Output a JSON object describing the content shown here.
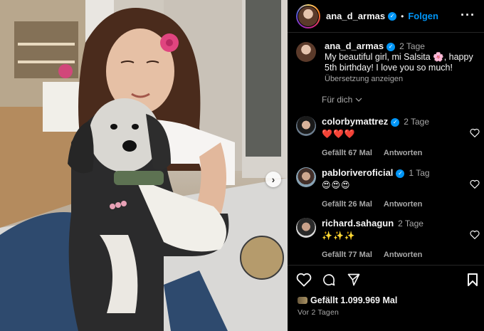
{
  "post": {
    "username": "ana_d_armas",
    "follow_label": "Folgen",
    "more_icon": "more-icon",
    "separator": "•"
  },
  "caption": {
    "username": "ana_d_armas",
    "time": "2 Tage",
    "text": "My beautiful girl, mi Salsita 🌸, happy 5th birthday! I love you so much!",
    "translate_label": "Übersetzung anzeigen"
  },
  "filter": {
    "label": "Für dich"
  },
  "comments": [
    {
      "username": "colorbymattrez",
      "time": "2 Tage",
      "text": "❤️❤️❤️",
      "likes_label": "Gefällt 67 Mal",
      "reply_label": "Antworten"
    },
    {
      "username": "pabloriveroficial",
      "time": "1 Tag",
      "text": "😍😍😍",
      "likes_label": "Gefällt 26 Mal",
      "reply_label": "Antworten"
    },
    {
      "username": "richard.sahagun",
      "time": "2 Tage",
      "text": "✨✨✨",
      "likes_label": "Gefällt 77 Mal",
      "reply_label": "Antworten"
    }
  ],
  "footer": {
    "likes_label": "Gefällt 1.099.969 Mal",
    "posted_ago": "Vor 2 Tagen"
  },
  "colors": {
    "accent": "#0095f6",
    "background": "#000000",
    "text": "#f5f5f5",
    "muted": "#a8a8a8"
  }
}
